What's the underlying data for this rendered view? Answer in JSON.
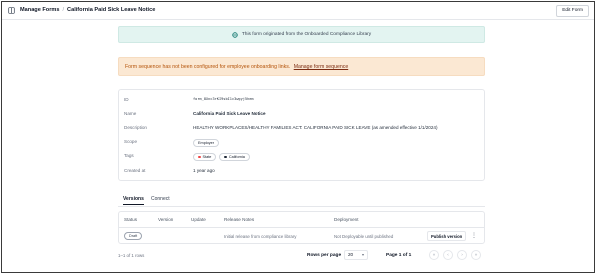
{
  "header": {
    "breadcrumb_root": "Manage Forms",
    "breadcrumb_sep": "/",
    "title": "California Paid Sick Leave Notice",
    "edit_label": "Edit Form"
  },
  "info_banner": {
    "text": "This form originated from the Onboarded Compliance Library"
  },
  "warn_banner": {
    "text": "Form sequence has not been configured for employee onboarding links.",
    "link": "Manage form sequence"
  },
  "details": {
    "id": {
      "label": "ID",
      "value": "form_8Xnc3rKI9sbI1c3wgyj5hem"
    },
    "name": {
      "label": "Name",
      "value": "California Paid Sick Leave Notice"
    },
    "description": {
      "label": "Description",
      "value": "HEALTHY WORKPLACES/HEALTHY FAMILIES ACT: CALIFORNIA PAID SICK LEAVE (as amended effective 1/1/2024)"
    },
    "scope": {
      "label": "Scope",
      "value": "Employer"
    },
    "tags": {
      "label": "Tags",
      "items": [
        {
          "label": "State",
          "color": "#ef4444"
        },
        {
          "label": "California",
          "color": "#1f2937"
        }
      ]
    },
    "created": {
      "label": "Created at",
      "value": "1 year ago"
    }
  },
  "tabs": [
    {
      "label": "Versions"
    },
    {
      "label": "Connect"
    }
  ],
  "table": {
    "columns": [
      "Status",
      "Version",
      "Update",
      "Release Notes",
      "Deployment"
    ],
    "rows": [
      {
        "status": "Draft",
        "version": "",
        "update": "",
        "release_notes": "Initial release from compliance library",
        "deployment": "Not Deployable until published",
        "action": "Publish version"
      }
    ]
  },
  "pagination": {
    "summary": "1–1 of 1 rows",
    "rows_per_page_label": "Rows per page",
    "rows_per_page": "20",
    "page_info": "Page 1 of 1",
    "first_icon": "«",
    "prev_icon": "‹",
    "next_icon": "›",
    "last_icon": "»"
  }
}
